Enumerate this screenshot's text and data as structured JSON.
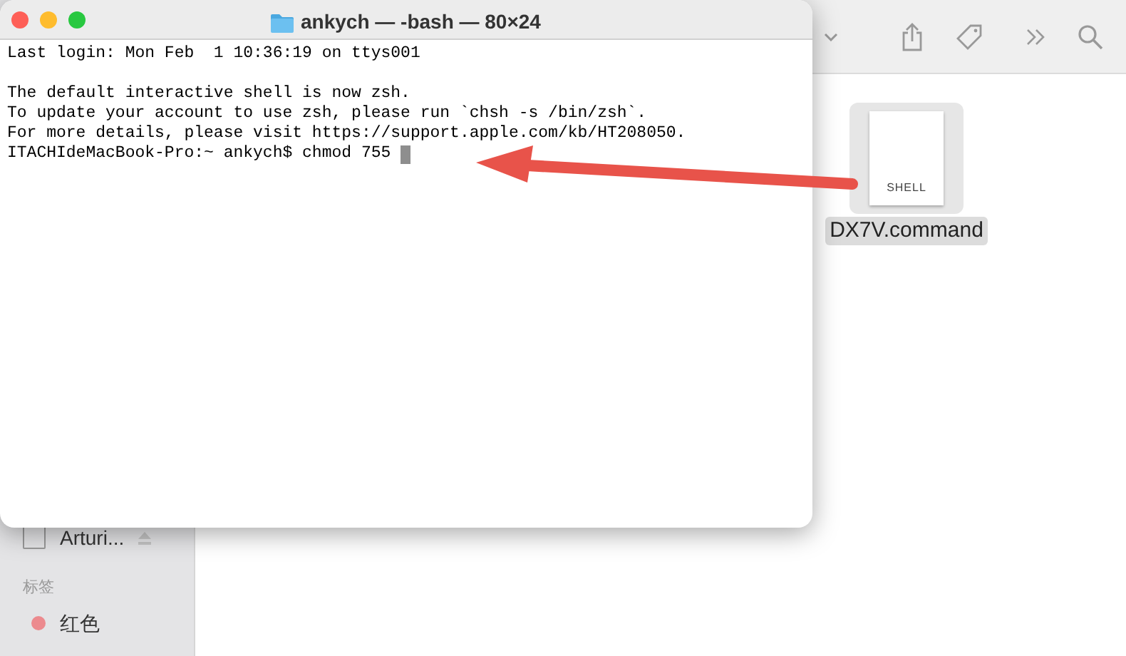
{
  "terminal": {
    "title": "ankych — -bash — 80×24",
    "paragraphs": [
      [
        "Last login: Mon Feb  1 10:36:19 on ttys001"
      ],
      [
        "The default interactive shell is now zsh.",
        "To update your account to use zsh, please run `chsh -s /bin/zsh`.",
        "For more details, please visit https://support.apple.com/kb/HT208050."
      ]
    ],
    "prompt": "ITACHIdeMacBook-Pro:~ ankych$ chmod 755 "
  },
  "finder": {
    "sidebar": {
      "items": [
        {
          "kind": "disk",
          "label": "Arturi..."
        },
        {
          "kind": "heading",
          "label": "标签"
        },
        {
          "kind": "tag",
          "label": "红色",
          "color": "#ec8a8e"
        }
      ]
    },
    "file": {
      "badge": "SHELL",
      "name": "DX7V.command",
      "selected": true
    }
  }
}
